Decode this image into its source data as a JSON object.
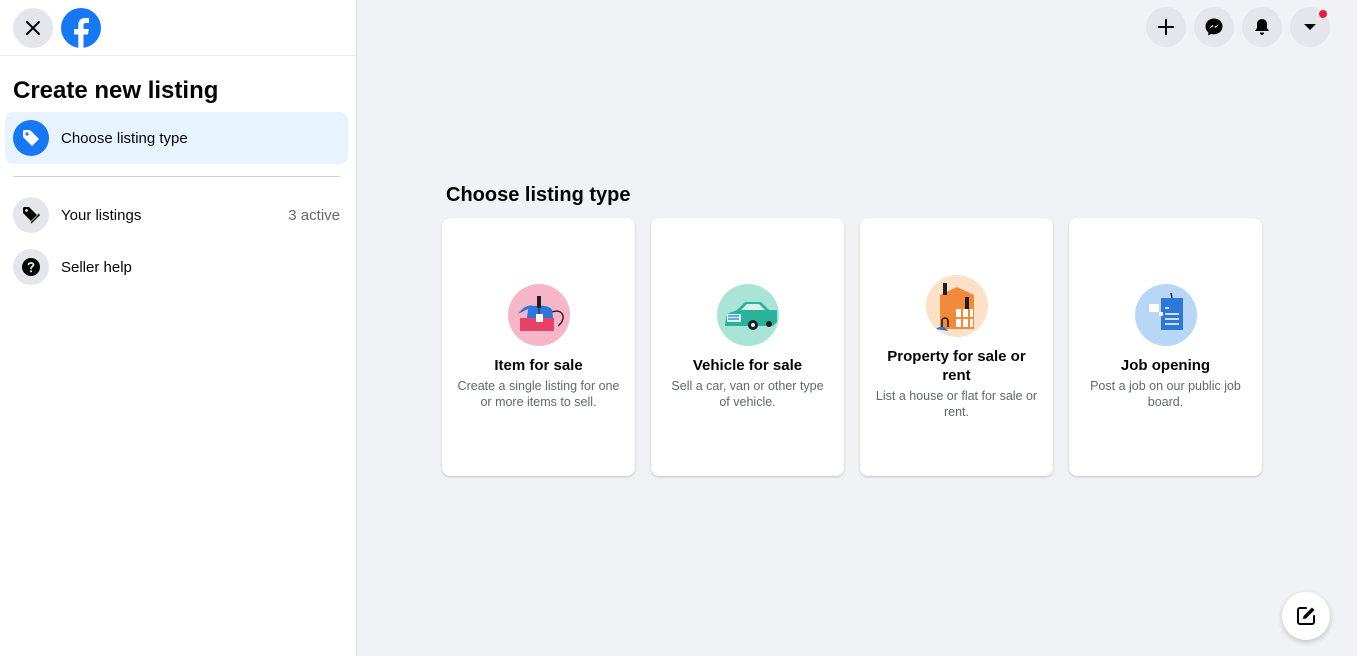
{
  "sidebar": {
    "title": "Create new listing",
    "items": [
      {
        "label": "Choose listing type",
        "icon": "tag-icon",
        "active": true
      },
      {
        "label": "Your listings",
        "meta": "3 active",
        "icon": "tags-icon"
      },
      {
        "label": "Seller help",
        "icon": "question-icon"
      }
    ]
  },
  "main": {
    "title": "Choose listing type",
    "cards": [
      {
        "title": "Item for sale",
        "desc": "Create a single listing for one or more items to sell.",
        "icon": "teapot-icon"
      },
      {
        "title": "Vehicle for sale",
        "desc": "Sell a car, van or other type of vehicle.",
        "icon": "car-icon"
      },
      {
        "title": "Property for sale or rent",
        "desc": "List a house or flat for sale or rent.",
        "icon": "house-icon"
      },
      {
        "title": "Job opening",
        "desc": "Post a job on our public job board.",
        "icon": "clipboard-icon"
      }
    ]
  },
  "colors": {
    "accent": "#1877f2",
    "badge": "#e41e3f",
    "background": "#f0f2f5"
  }
}
